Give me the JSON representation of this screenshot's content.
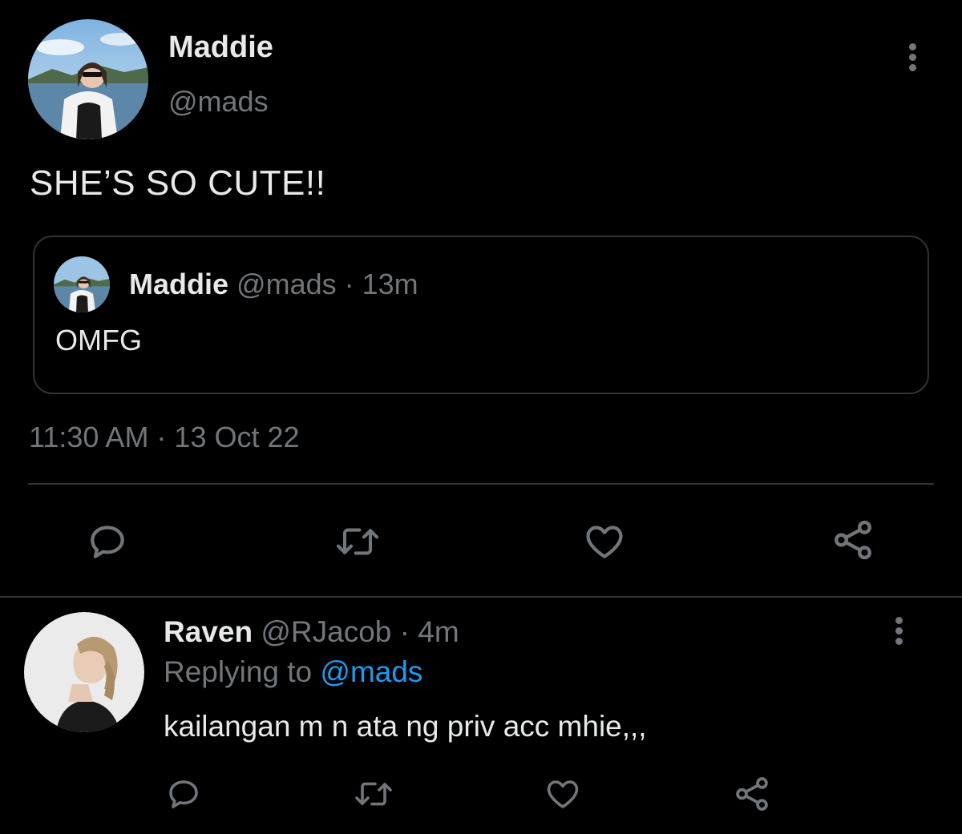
{
  "tweet": {
    "author_name": "Maddie",
    "author_handle": "@mads",
    "text": "SHE’S SO CUTE!!",
    "timestamp": "11:30 AM · 13 Oct 22",
    "quoted": {
      "author_name": "Maddie",
      "author_handle": "@mads",
      "separator": "·",
      "time": "13m",
      "text": "OMFG"
    }
  },
  "reply": {
    "author_name": "Raven",
    "author_handle": "@RJacob",
    "separator": "·",
    "time": "4m",
    "replying_prefix": "Replying to",
    "replying_mention": "@mads",
    "text": "kailangan m n ata ng priv acc mhie,,,"
  },
  "icons": {
    "reply": "comment-icon",
    "retweet": "retweet-icon",
    "like": "heart-icon",
    "share": "share-icon",
    "more": "more-vertical-icon"
  },
  "colors": {
    "background": "#000000",
    "primary_text": "#e7e9ea",
    "secondary_text": "#71767b",
    "link": "#1d9bf0",
    "border": "#2f3336"
  }
}
